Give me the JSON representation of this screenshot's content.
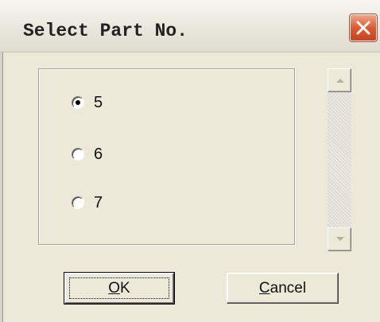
{
  "window": {
    "title": "Select Part No.",
    "close_icon": "close-x-icon",
    "close_color": "#dd5a31"
  },
  "options": {
    "items": [
      {
        "label": "5",
        "checked": true
      },
      {
        "label": "6",
        "checked": false
      },
      {
        "label": "7",
        "checked": false
      }
    ]
  },
  "scrollbar": {
    "up_icon": "scroll-up-arrow-icon",
    "down_icon": "scroll-down-arrow-icon"
  },
  "buttons": {
    "ok": {
      "mnemonic": "O",
      "rest": "K"
    },
    "cancel": {
      "mnemonic": "C",
      "rest": "ancel"
    }
  }
}
